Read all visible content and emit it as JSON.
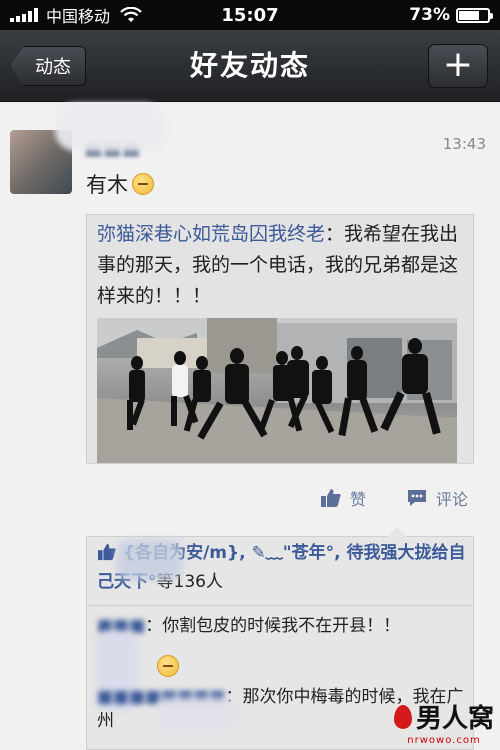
{
  "status_bar": {
    "carrier": "中国移动",
    "time": "15:07",
    "battery": "73%",
    "battery_level": 0.73
  },
  "nav": {
    "back_label": "动态",
    "title": "好友动态",
    "add_label": "+"
  },
  "post": {
    "time": "13:43",
    "text": "有木",
    "shared": {
      "source": "弥猫深巷心如荒岛囚我终老",
      "separator": "：",
      "body": "我希望在我出事的那天，我的一个电话，我的兄弟都是这样来的！！！"
    },
    "actions": {
      "like": "赞",
      "comment": "评论"
    }
  },
  "likes": {
    "names": "{各自为安/m}, ✎﹏\"苍年°, 待我强大拢给自己天下°",
    "count_text": "等136人"
  },
  "comments": [
    {
      "text": "你割包皮的时候我不在开县！！"
    },
    {
      "text": "那次你中梅毒的时候，我在广州"
    }
  ],
  "watermark": {
    "main": "男人窝",
    "sub": "nrwowo.com"
  }
}
